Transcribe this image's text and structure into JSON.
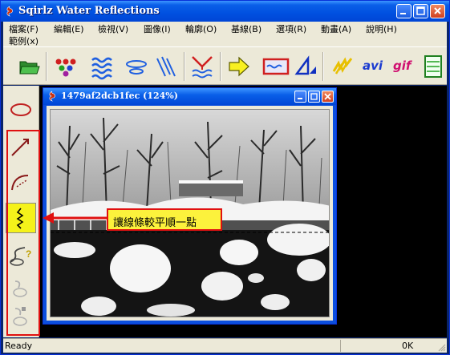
{
  "window": {
    "title": "Sqirlz Water Reflections",
    "icon": "squirrel-app-icon"
  },
  "menu": {
    "items": [
      {
        "label": "檔案(F)"
      },
      {
        "label": "編輯(E)"
      },
      {
        "label": "檢視(V)"
      },
      {
        "label": "圖像(I)"
      },
      {
        "label": "輪廓(O)"
      },
      {
        "label": "基線(B)"
      },
      {
        "label": "選項(R)"
      },
      {
        "label": "動畫(A)"
      },
      {
        "label": "說明(H)"
      },
      {
        "label": "範例(x)"
      }
    ]
  },
  "toolbar": {
    "icons": [
      "open-folder-icon",
      "color-dots-icon",
      "waves-icon",
      "ripple-icon",
      "diagonal-lines-icon",
      "reflection-icon",
      "arrow-right-icon",
      "water-frame-icon",
      "perspective-icon",
      "lightning-icon"
    ],
    "avi_label": "avi",
    "gif_label": "gif"
  },
  "left_tools": {
    "icons": [
      "ellipse-icon",
      "line-arrow-icon",
      "curve-icon",
      "smooth-line-icon",
      "help-curve-icon",
      "disabled-curve-icon",
      "disabled-curve-2-icon"
    ],
    "active_index": 3
  },
  "child_window": {
    "title": "1479af2dcb1fec  (124%)"
  },
  "callout": {
    "text": "讓線條較平順一點"
  },
  "status": {
    "left": "Ready",
    "right": "0K"
  },
  "colors": {
    "titlebar": "#0050e0",
    "highlight": "#fcf23c",
    "frame": "#e01010"
  }
}
